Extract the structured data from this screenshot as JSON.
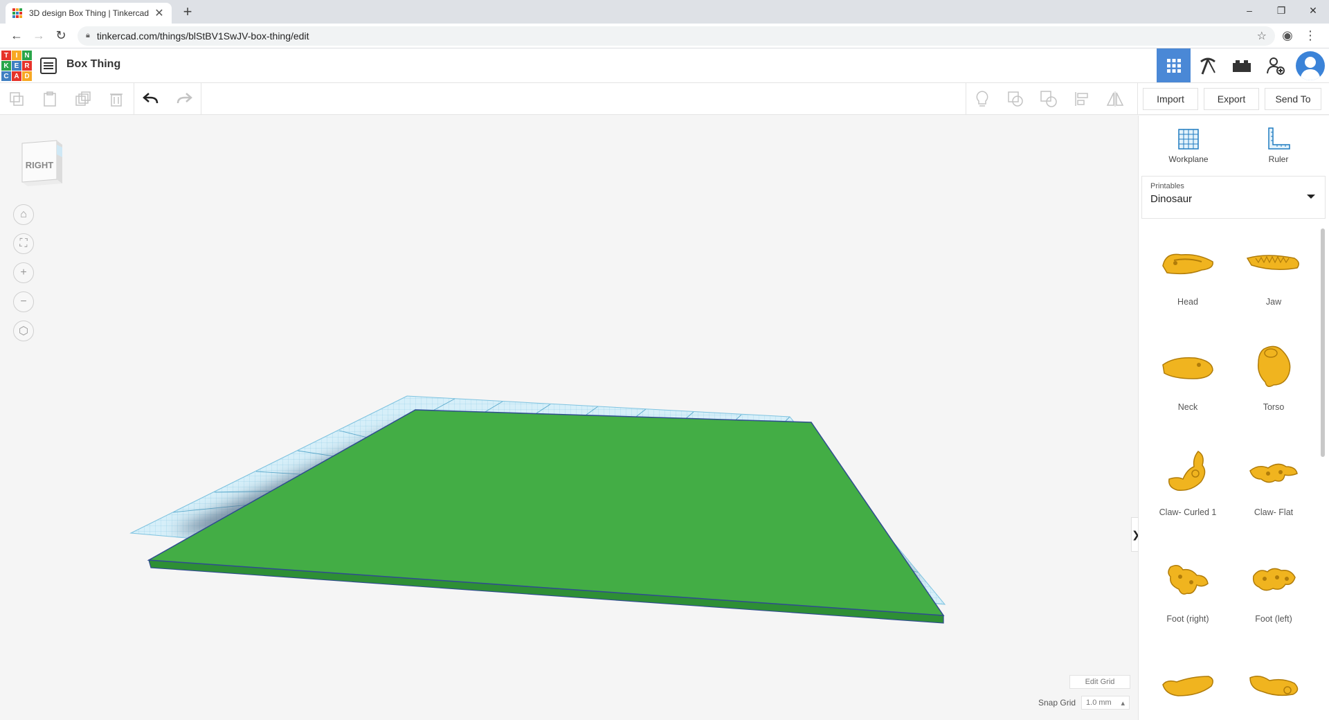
{
  "browser": {
    "tab_title": "3D design Box Thing | Tinkercad",
    "tab_close": "✕",
    "new_tab": "+",
    "url": "tinkercad.com/things/blStBV1SwJV-box-thing/edit",
    "window_controls": [
      "–",
      "❐",
      "✕"
    ]
  },
  "app": {
    "logo_letters": [
      "T",
      "I",
      "N",
      "K",
      "E",
      "R",
      "C",
      "A",
      "D"
    ],
    "logo_colors": [
      "#e6332a",
      "#f7a823",
      "#2aa54a",
      "#2aa54a",
      "#3f7fc1",
      "#e6332a",
      "#3f7fc1",
      "#e6332a",
      "#f7a823"
    ],
    "design_title": "Box Thing",
    "accent_color": "#4a88d6"
  },
  "toolbar": {
    "import_label": "Import",
    "export_label": "Export",
    "send_to_label": "Send To"
  },
  "viewcube": {
    "face_label": "RIGHT"
  },
  "grid": {
    "edit_grid_label": "Edit Grid",
    "snap_grid_label": "Snap Grid",
    "snap_grid_value": "1.0 mm"
  },
  "panel": {
    "workplane_label": "Workplane",
    "ruler_label": "Ruler",
    "library_caption": "Printables",
    "library_value": "Dinosaur",
    "shapes": [
      {
        "label": "Head"
      },
      {
        "label": "Jaw"
      },
      {
        "label": "Neck"
      },
      {
        "label": "Torso"
      },
      {
        "label": "Claw- Curled 1"
      },
      {
        "label": "Claw- Flat"
      },
      {
        "label": "Foot (right)"
      },
      {
        "label": "Foot (left)"
      },
      {
        "label": ""
      },
      {
        "label": ""
      }
    ],
    "collapse_glyph": "❯"
  },
  "scene": {
    "box_color": "#43ad45",
    "box_edge_color": "#2f4c8f",
    "workplane_color": "#bfe6f5"
  }
}
